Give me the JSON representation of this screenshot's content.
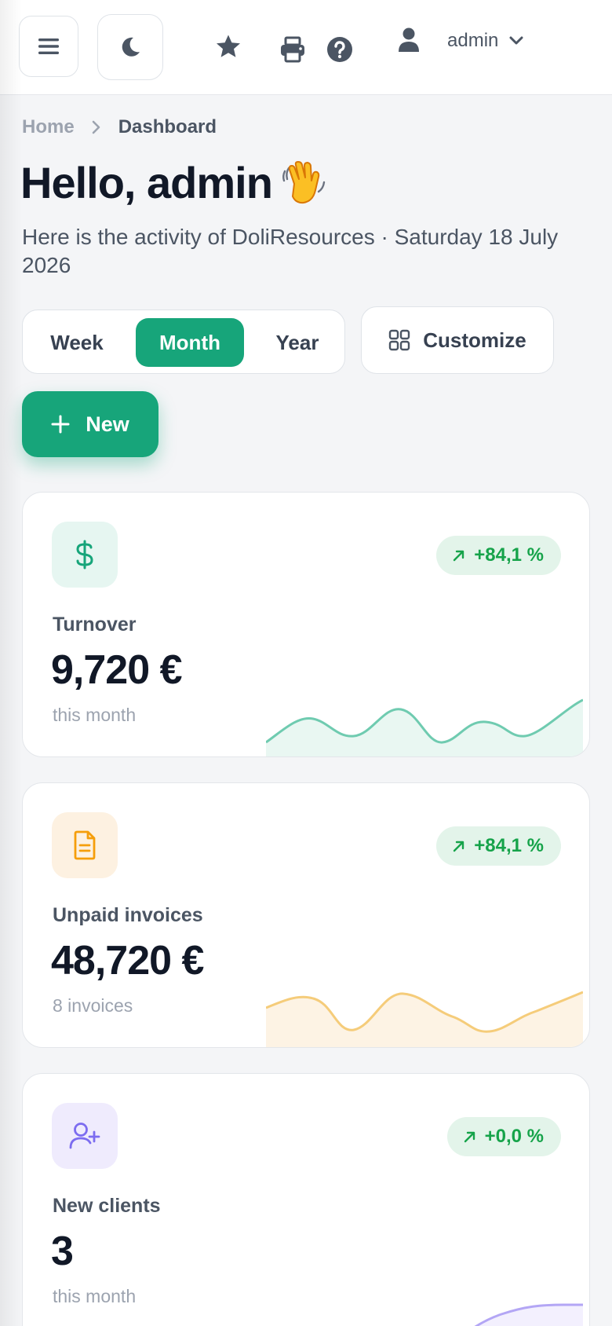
{
  "topbar": {
    "user_name": "admin",
    "icons": [
      "menu-icon",
      "moon-icon",
      "star-icon",
      "print-icon",
      "help-icon",
      "user-icon",
      "chevron-down-icon"
    ]
  },
  "breadcrumb": {
    "home": "Home",
    "current": "Dashboard"
  },
  "header": {
    "greeting": "Hello, admin",
    "subtitle": "Here is the activity of DoliResources · Saturday 18 July 2026"
  },
  "period": {
    "week": "Week",
    "month": "Month",
    "year": "Year",
    "selected": "Month"
  },
  "actions": {
    "customize": "Customize",
    "new": "New"
  },
  "colors": {
    "accent": "#17a57a",
    "trend_up": "#16a34a",
    "turnover": "#6fcbb0",
    "invoices": "#f5cc7a",
    "clients": "#b3a6f5"
  },
  "cards": [
    {
      "label": "Turnover",
      "value": "9,720 €",
      "sub": "this month",
      "trend": "+84,1 %",
      "icon": "dollar-icon"
    },
    {
      "label": "Unpaid invoices",
      "value": "48,720 €",
      "sub": "8 invoices",
      "trend": "+84,1 %",
      "icon": "document-icon"
    },
    {
      "label": "New clients",
      "value": "3",
      "sub": "this month",
      "trend": "+0,0 %",
      "icon": "user-plus-icon"
    }
  ]
}
